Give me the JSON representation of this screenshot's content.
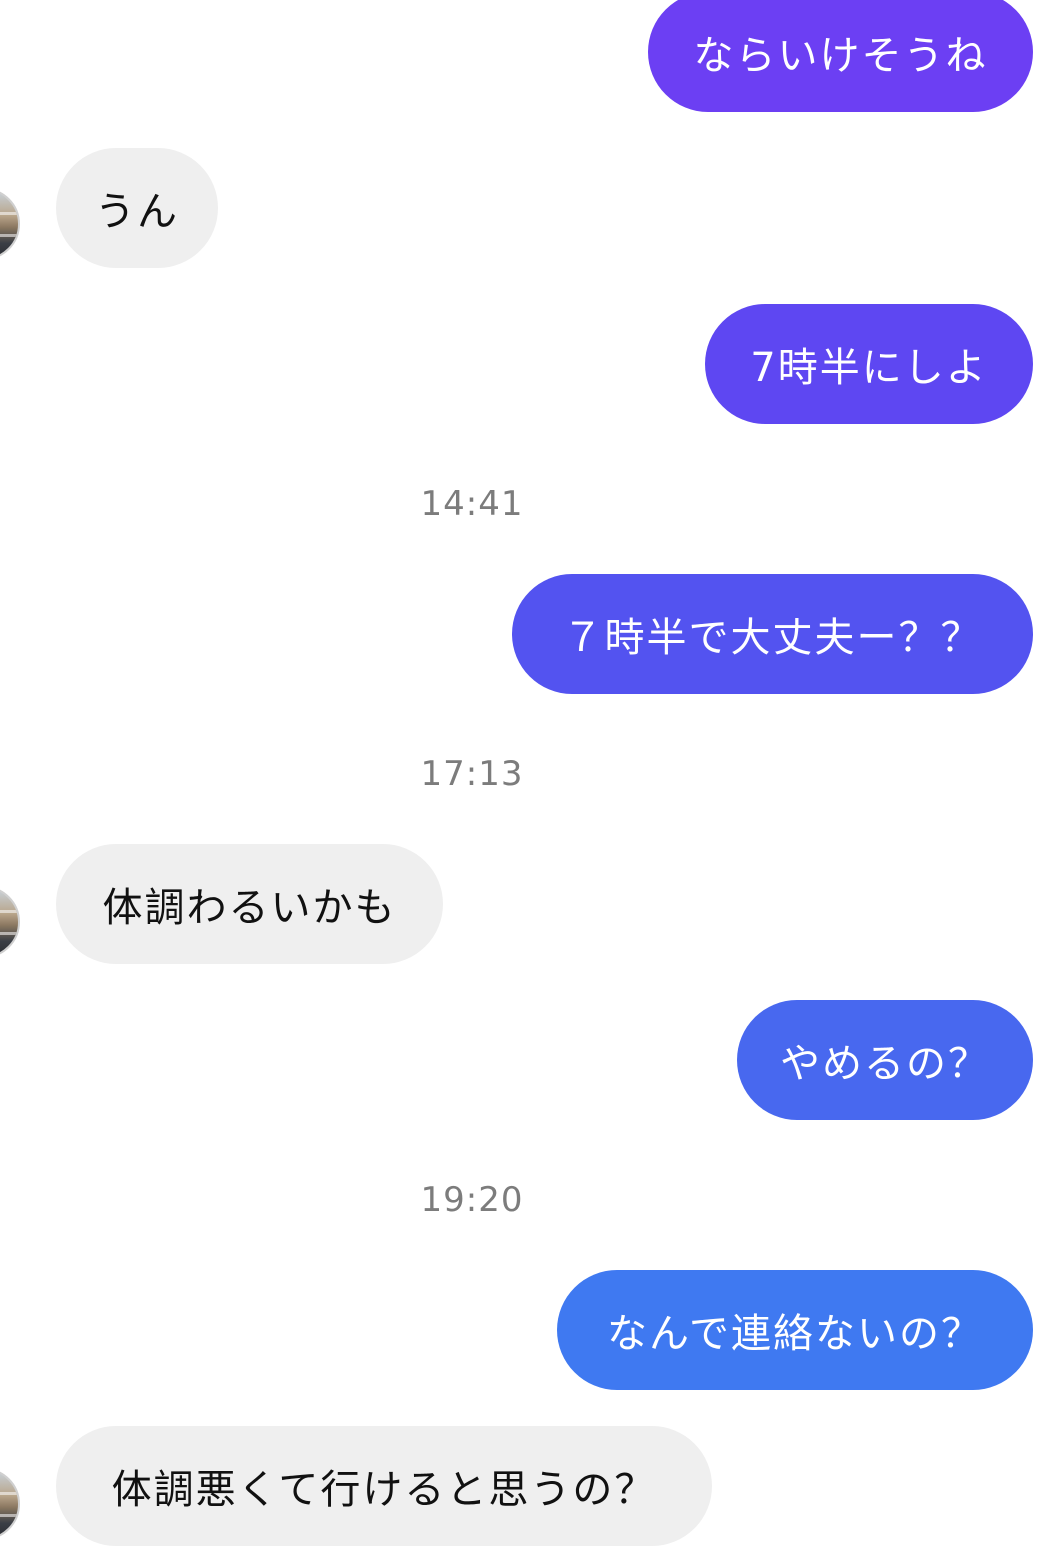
{
  "messages": [
    {
      "text": "ならいけそうね",
      "sender": "me",
      "color": "#6c3ff3"
    },
    {
      "text": "うん",
      "sender": "them",
      "color": "#efefef"
    },
    {
      "text": "7時半にしよ",
      "sender": "me",
      "color": "#5e47f2"
    },
    {
      "text": "７時半で大丈夫ー？？",
      "sender": "me",
      "color": "#5353f0"
    },
    {
      "text": "体調わるいかも",
      "sender": "them",
      "color": "#efefef"
    },
    {
      "text": "やめるの？",
      "sender": "me",
      "color": "#4868ef"
    },
    {
      "text": "なんで連絡ないの？",
      "sender": "me",
      "color": "#3f79f1"
    },
    {
      "text": "体調悪くて行けると思うの？",
      "sender": "them",
      "color": "#efefef"
    }
  ],
  "timestamps": [
    "14:41",
    "17:13",
    "19:20"
  ],
  "avatar_icon": "user-avatar-icon"
}
